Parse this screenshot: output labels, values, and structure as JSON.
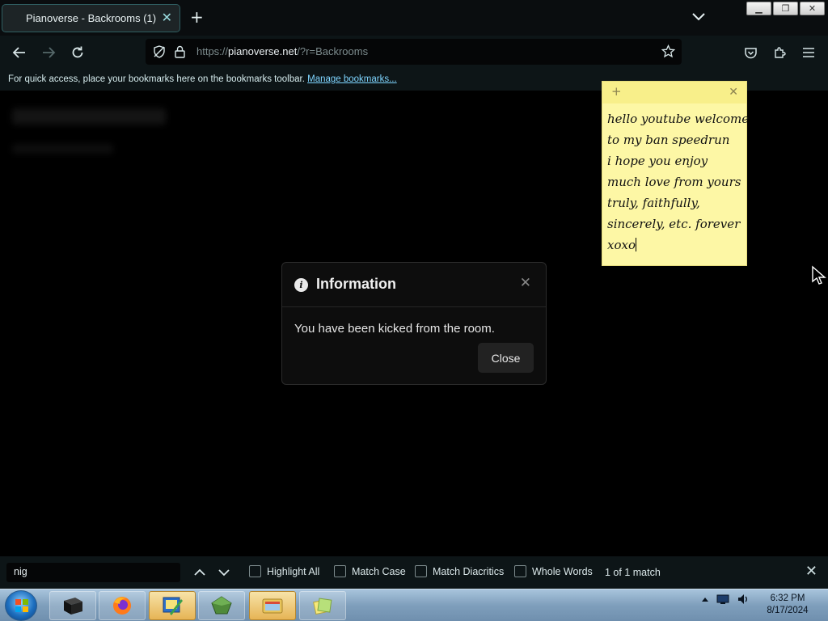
{
  "browser": {
    "tab": {
      "title": "Pianoverse - Backrooms (1)",
      "close_glyph": "✕"
    },
    "new_tab_glyph": "+",
    "url": {
      "prefix": "https://",
      "host": "pianoverse.net",
      "path": "/?r=Backrooms"
    },
    "bookmarks_bar": {
      "text": "For quick access, place your bookmarks here on the bookmarks toolbar.",
      "link": "Manage bookmarks..."
    },
    "window_buttons": {
      "minimize": "▁",
      "restore": "❐",
      "close": "✕"
    }
  },
  "modal": {
    "icon": "info-icon",
    "title": "Information",
    "message": "You have been kicked from the room.",
    "close_label": "Close",
    "x_glyph": "✕"
  },
  "sticky_note": {
    "add_glyph": "+",
    "close_glyph": "✕",
    "lines": [
      "hello youtube welcome",
      "to my ban speedrun",
      "i hope you enjoy",
      "much love from yours",
      "truly, faithfully,",
      "sincerely, etc. forever",
      "xoxo"
    ]
  },
  "find_bar": {
    "query": "nig",
    "options": [
      {
        "label": "Highlight All",
        "checked": false
      },
      {
        "label": "Match Case",
        "checked": false
      },
      {
        "label": "Match Diacritics",
        "checked": false
      },
      {
        "label": "Whole Words",
        "checked": false
      }
    ],
    "status": "1 of 1 match",
    "close_glyph": "✕"
  },
  "taskbar": {
    "clock": {
      "time": "6:32 PM",
      "date": "8/17/2024"
    }
  },
  "colors": {
    "accent": "#9bdde0",
    "link": "#7fd5ff",
    "sticky": "#fdf7a5"
  }
}
